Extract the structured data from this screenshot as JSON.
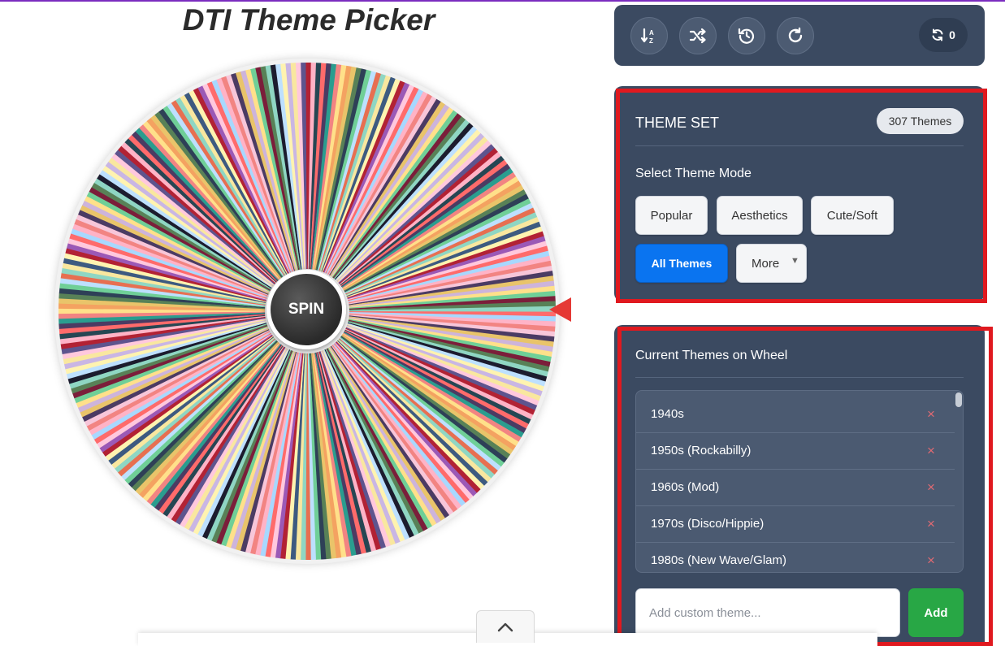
{
  "title": "DTI Theme Picker",
  "wheel": {
    "spin_label": "SPIN",
    "segment_colors": [
      "#ff6b6b",
      "#f7c6d9",
      "#ffe08a",
      "#2e4057",
      "#8fd6c3",
      "#c9b6e4",
      "#b22234",
      "#a8d8ff",
      "#4b3b63",
      "#f4a261",
      "#6fcf97",
      "#1c1c2e",
      "#f9e79f",
      "#9b59b6",
      "#ffb3c6",
      "#2a9d8f",
      "#e9c46a",
      "#7b1e3a",
      "#bde0fe",
      "#3d5a80",
      "#ffc8dd",
      "#264653",
      "#f28482",
      "#cdb4db",
      "#588157",
      "#e76f51",
      "#fff3b0",
      "#5e548e"
    ],
    "pointer_color": "#e53935"
  },
  "toolbar": {
    "sort_icon": "sort-alpha-icon",
    "shuffle_icon": "shuffle-icon",
    "history_icon": "history-icon",
    "reset_icon": "redo-icon",
    "counter_icon": "sync-icon",
    "counter_value": "0"
  },
  "theme_set": {
    "heading": "THEME SET",
    "count_badge": "307 Themes",
    "mode_heading": "Select Theme Mode",
    "modes": {
      "popular": "Popular",
      "aesthetics": "Aesthetics",
      "cute_soft": "Cute/Soft",
      "all_themes": "All Themes",
      "more": "More"
    },
    "active_mode": "All Themes"
  },
  "current_themes": {
    "heading": "Current Themes on Wheel",
    "items": [
      {
        "name": "1940s",
        "remove": "×"
      },
      {
        "name": "1950s (Rockabilly)",
        "remove": "×"
      },
      {
        "name": "1960s (Mod)",
        "remove": "×"
      },
      {
        "name": "1970s (Disco/Hippie)",
        "remove": "×"
      },
      {
        "name": "1980s (New Wave/Glam)",
        "remove": "×"
      }
    ],
    "input_placeholder": "Add custom theme...",
    "add_label": "Add"
  },
  "colors": {
    "panel_bg": "#3b4a61",
    "active_button": "#0a74f0",
    "add_button": "#28a745",
    "highlight": "#e0191f",
    "remove_x": "#e26a72"
  }
}
